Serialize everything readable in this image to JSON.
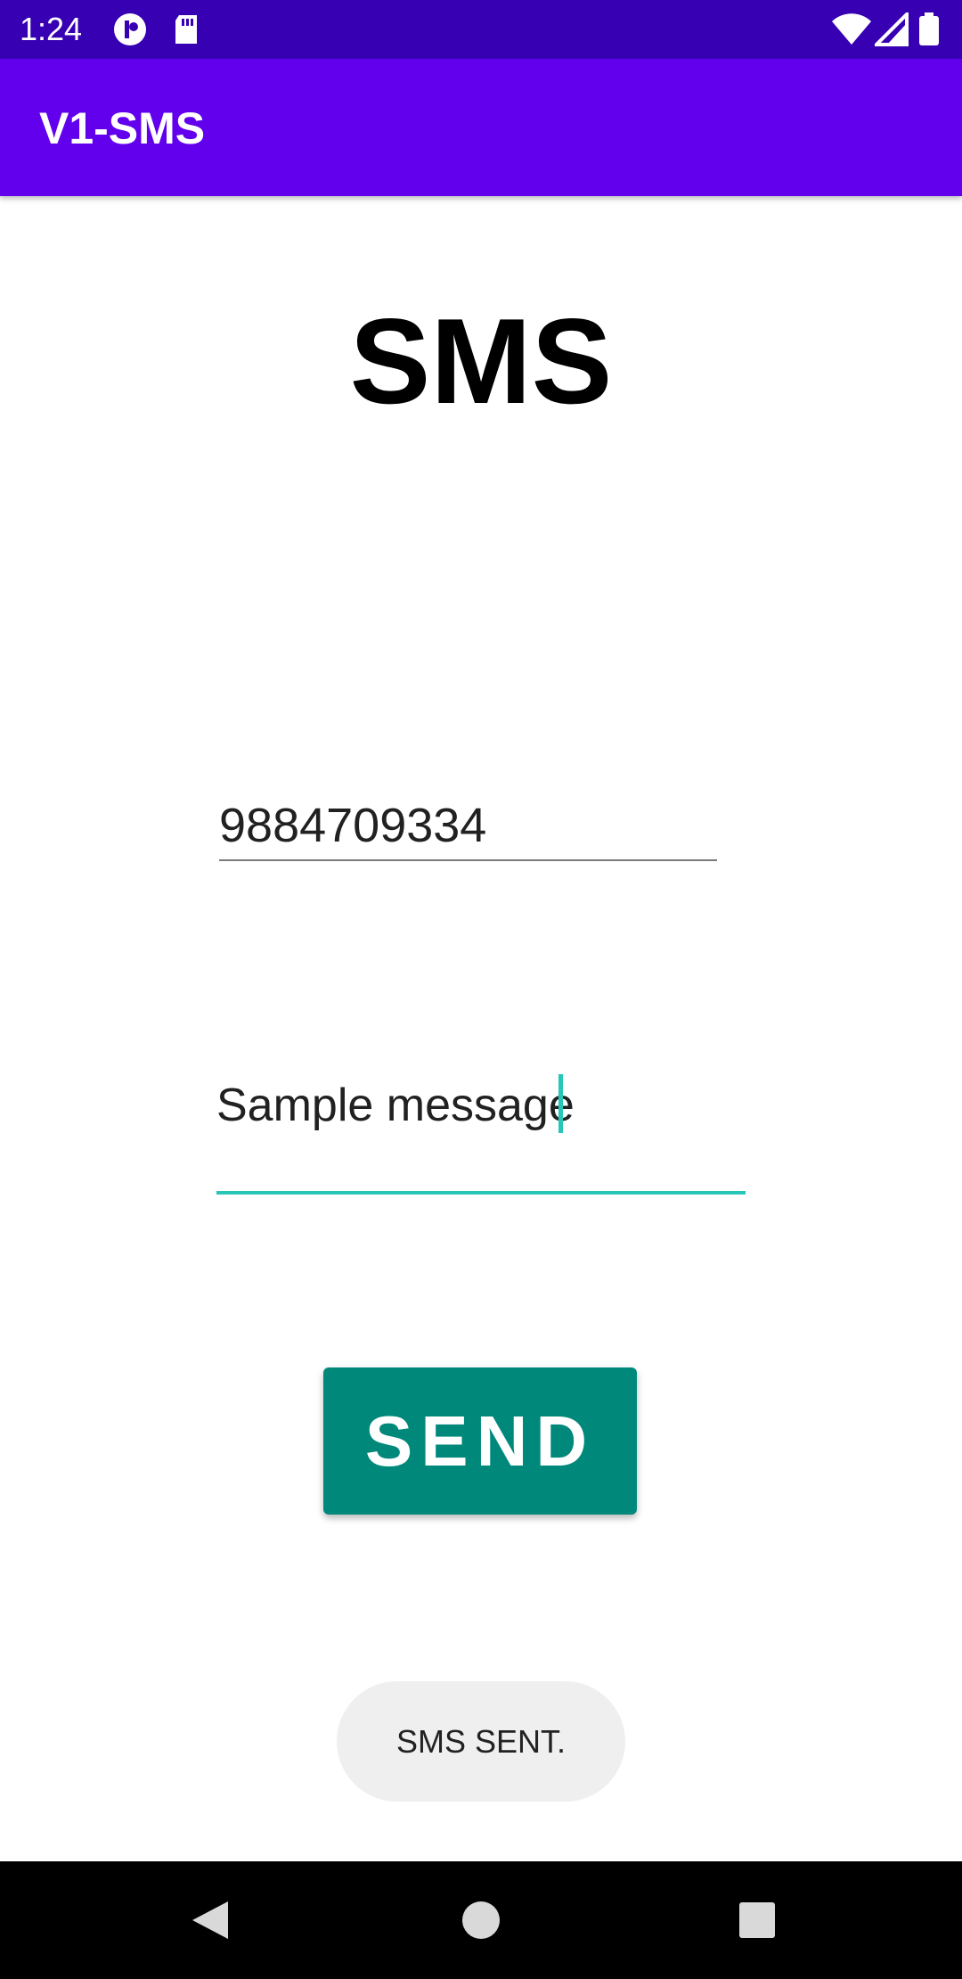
{
  "status_bar": {
    "time": "1:24",
    "left_icons": [
      "notification-icon",
      "sd-card-icon"
    ],
    "right_icons": [
      "wifi-icon",
      "cellular-signal-icon",
      "battery-icon"
    ],
    "background": "#3700b3"
  },
  "app_bar": {
    "title": "V1-SMS",
    "background": "#6200ee"
  },
  "main": {
    "heading": "SMS",
    "phone_field": {
      "value": "9884709334"
    },
    "message_field": {
      "value": "Sample message",
      "accent": "#26c6b8"
    },
    "send_button": {
      "label": "SEND",
      "background": "#00897b"
    }
  },
  "toast": {
    "text": "SMS SENT."
  },
  "nav_bar": {
    "buttons": [
      "back-icon",
      "home-icon",
      "recents-icon"
    ]
  }
}
